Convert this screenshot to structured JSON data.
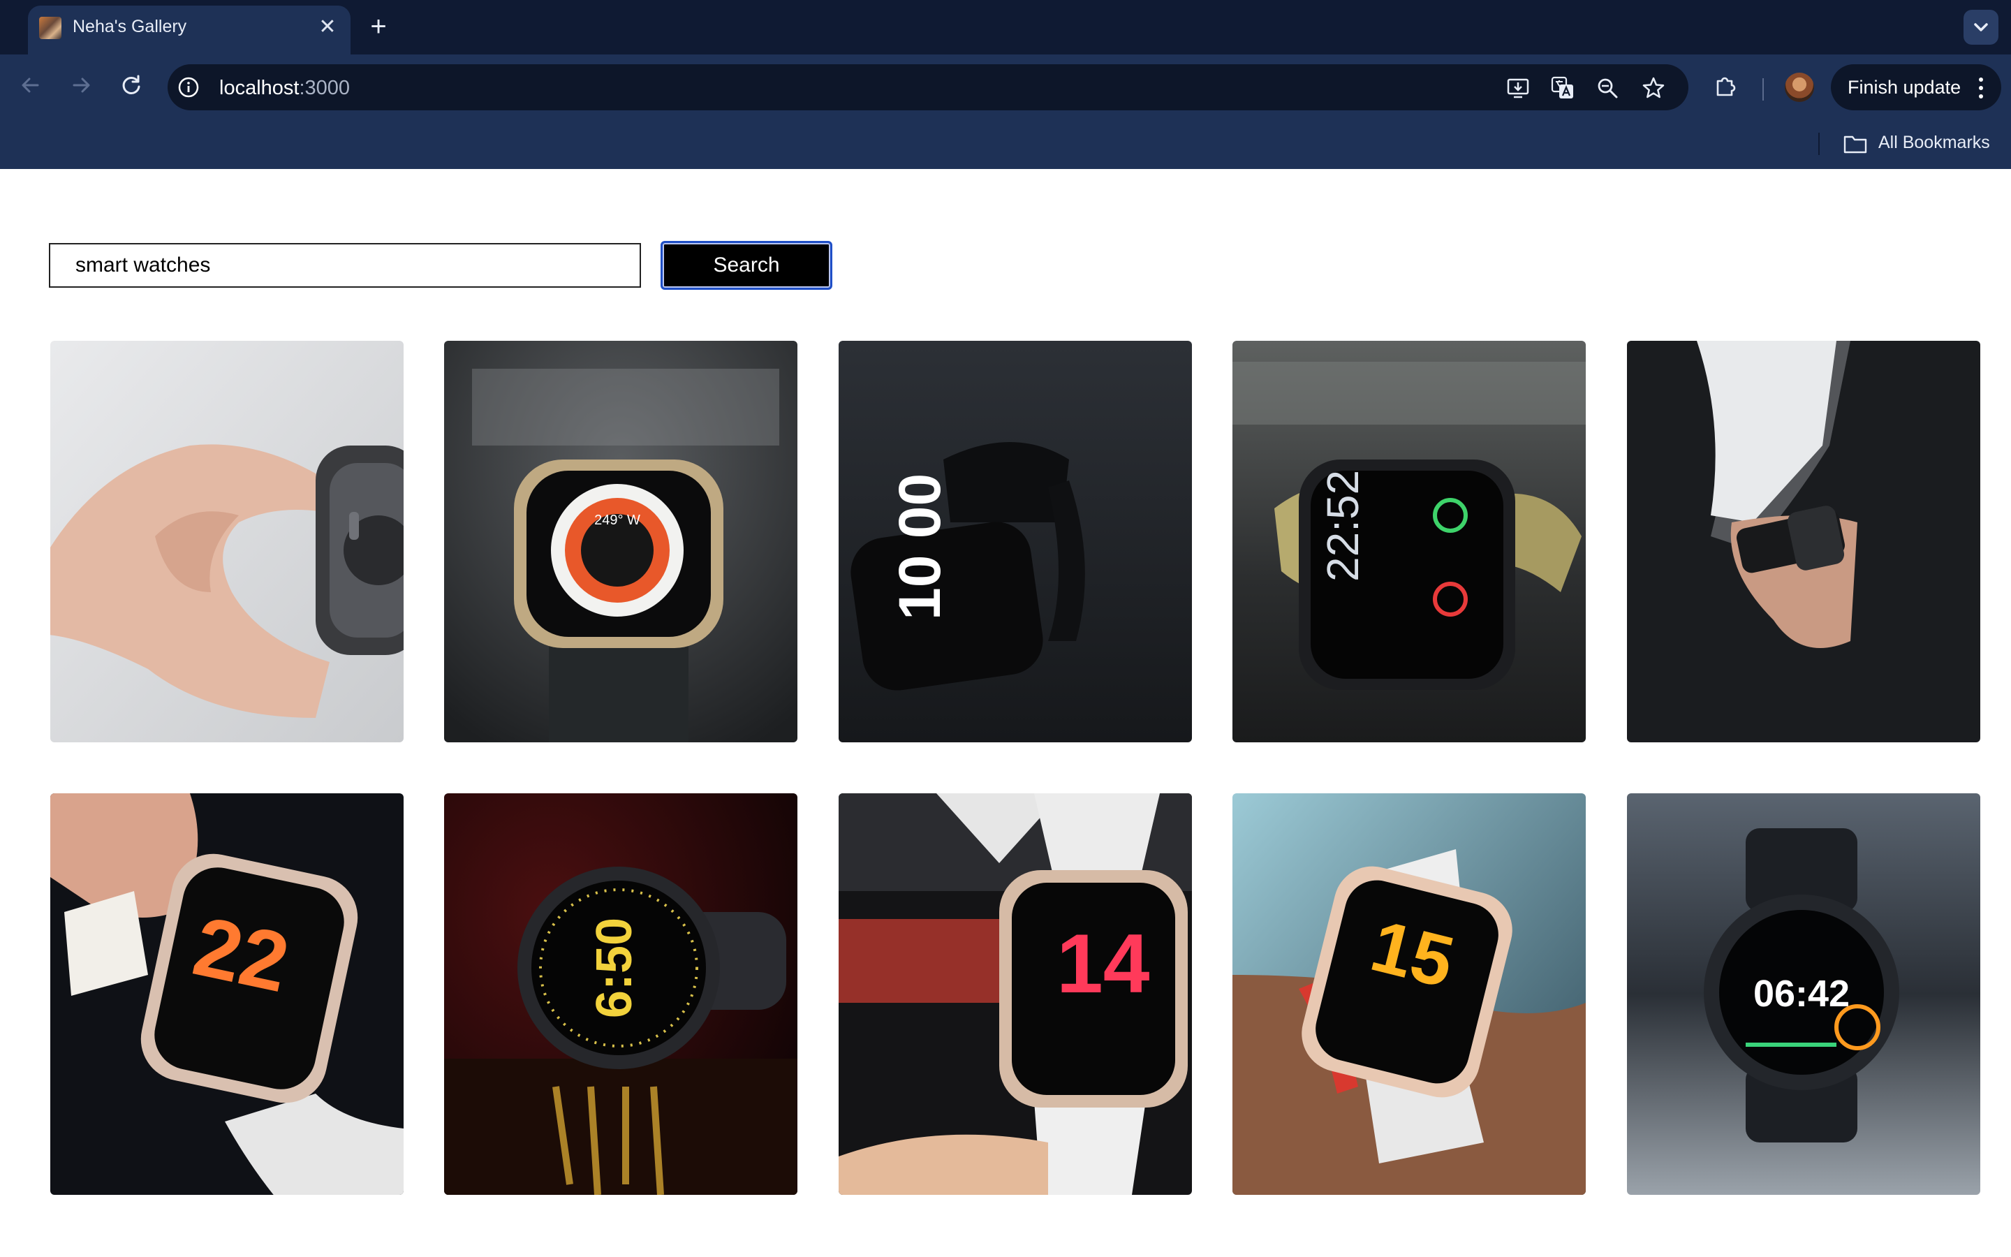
{
  "browser": {
    "tab_title": "Neha's Gallery",
    "url_host": "localhost",
    "url_port": ":3000",
    "finish_update_label": "Finish update",
    "bookmarks_label": "All Bookmarks"
  },
  "search": {
    "value": "smart watches",
    "button_label": "Search"
  },
  "gallery": {
    "images": [
      {
        "subject": "hand holding watch back",
        "face": ""
      },
      {
        "subject": "rugged watch with orange dial",
        "face": "249° W"
      },
      {
        "subject": "black watch on fabric",
        "face": "10 00"
      },
      {
        "subject": "watch with olive band",
        "face": "22:52"
      },
      {
        "subject": "watch on wrist with white sleeve",
        "face": ""
      },
      {
        "subject": "hand tapping watch",
        "face": "22"
      },
      {
        "subject": "round watch in dark",
        "face": "6:50"
      },
      {
        "subject": "white strap watch",
        "face": "14"
      },
      {
        "subject": "watch on wrist with red bracelet",
        "face": "15"
      },
      {
        "subject": "round watch on table",
        "face": "06:42"
      }
    ]
  }
}
